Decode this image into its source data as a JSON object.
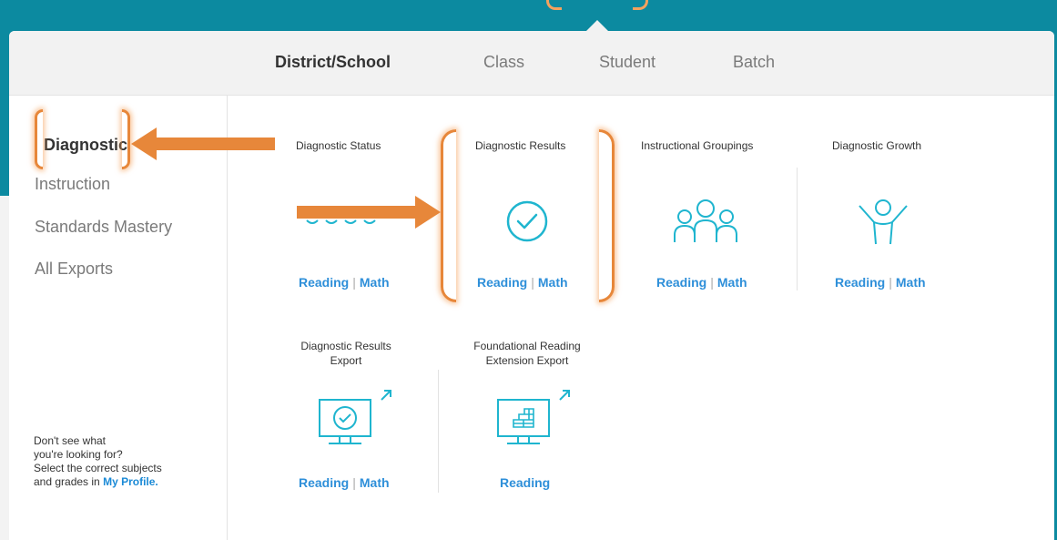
{
  "tabs": {
    "district_school": "District/School",
    "class": "Class",
    "student": "Student",
    "batch": "Batch"
  },
  "sidebar": {
    "items": [
      "Diagnostic",
      "Instruction",
      "Standards Mastery",
      "All Exports"
    ],
    "help_text_line1": "Don't see what",
    "help_text_line2": "you're looking for?",
    "help_text_line3": "Select the correct subjects",
    "help_text_line4": "and grades in",
    "help_link": "My Profile."
  },
  "reports": {
    "diagnostic_status": {
      "title": "Diagnostic Status",
      "link1": "Reading",
      "link2": "Math"
    },
    "diagnostic_results": {
      "title": "Diagnostic Results",
      "link1": "Reading",
      "link2": "Math"
    },
    "instructional_groupings": {
      "title": "Instructional Groupings",
      "link1": "Reading",
      "link2": "Math"
    },
    "diagnostic_growth": {
      "title": "Diagnostic Growth",
      "link1": "Reading",
      "link2": "Math"
    },
    "diagnostic_results_export": {
      "title_line1": "Diagnostic Results",
      "title_line2": "Export",
      "link1": "Reading",
      "link2": "Math"
    },
    "foundational_reading_export": {
      "title_line1": "Foundational Reading",
      "title_line2": "Extension Export",
      "link1": "Reading"
    }
  },
  "separator": "|",
  "colors": {
    "accent": "#1fb5cf",
    "link": "#2e8fd9",
    "annotation": "#e7873a",
    "header_bg": "#0c8aa0"
  }
}
